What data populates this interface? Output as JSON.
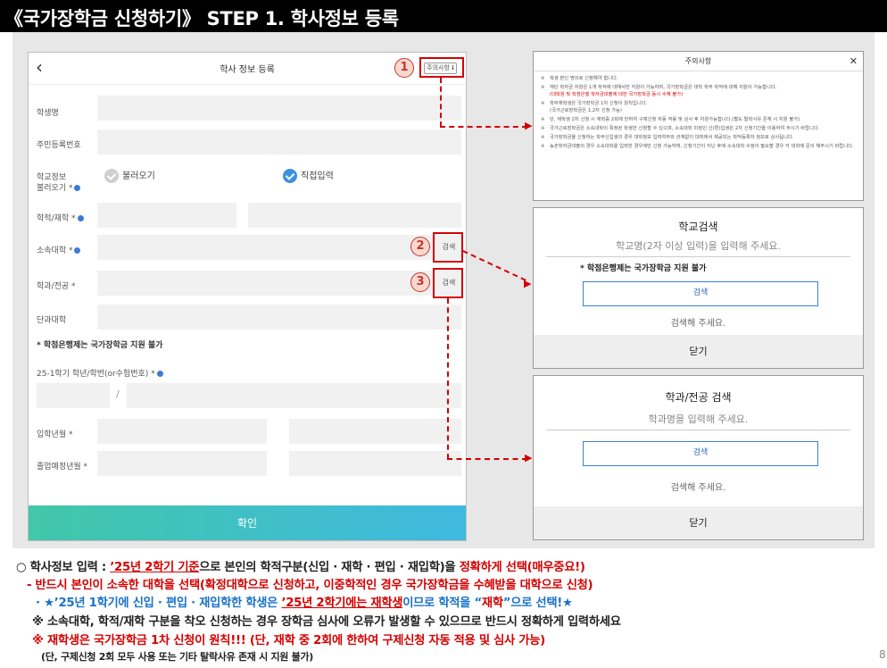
{
  "header": {
    "title": "《국가장학금 신청하기》 STEP 1. 학사정보 등록"
  },
  "form": {
    "title": "학사 정보 등록",
    "notice_button": "주의사항",
    "fields": {
      "name": "학생명",
      "rrn": "주민등록번호",
      "school_info_line1": "학교정보",
      "school_info_line2": "불러오기 *",
      "status": "학적/재학 *",
      "university": "소속대학 *",
      "department": "학과/전공 *",
      "college": "단과대학",
      "grade": "25-1학기 학년/학번(or수험번호) *",
      "admission": "입학년월 *",
      "graduation": "졸업예정년월 *"
    },
    "radio_load": "불러오기",
    "radio_direct": "직접입력",
    "search_label": "검색",
    "credit_bank_note": "* 학점은행제는 국가장학금 지원 불가",
    "slash": "/",
    "confirm_button": "확인"
  },
  "markers": [
    "1",
    "2",
    "3"
  ],
  "notice_panel": {
    "title": "주의사항",
    "close": "✕",
    "items": [
      {
        "text": "학생 본인 명의로 신청해야 합니다.",
        "red": "",
        "sub": ""
      },
      {
        "text": "재단 학자금 지원은 1개 학적에 대해서만 지원이 가능하며, 국가장학금은 대학 학부 학적에 대해 지원이 가능합니다.",
        "red": "(대학원 및 학점은행 학자금대출에 대한 국가장학금 동시 수혜 불가)",
        "sub": ""
      },
      {
        "text": "학부재학생은 국가장학금 1차 신청이 원칙입니다.",
        "red": "",
        "sub": "(국가근로장학금은 1,2차 신청 가능)"
      },
      {
        "text": "단, 재학생 2차 신청 시 재학중 2회에 한하여 구제신청 자동 적용 및 심사 후 지원가능합니다.(별도 탈락사유 존재 시 지원 불가)",
        "red": "",
        "sub": ""
      },
      {
        "text": "국가근로장학금은 소속대학이 확정된 학생만 신청할 수 있으며, 소속대학 미정인 신(편)입생은 2차 신청기간을 이용하여 주시기 바랍니다.",
        "red": "",
        "sub": ""
      },
      {
        "text": "국가장학금을 신청하는 학부신입생의 경우 대학정보 입력여부와 관계없이 대학에서 제공되는 학적등록자 정보로 심사됩니다.",
        "red": "",
        "sub": ""
      },
      {
        "text": "농촌학자금대출의 경우 소속대학을 입력한 경우에만 신청 가능하며, 신청기간이 지난 후에 소속대학 수정이 필요할 경우 각 대학에 문의 해주시기 바랍니다.",
        "red": "",
        "sub": ""
      }
    ]
  },
  "school_search_panel": {
    "title": "학교검색",
    "placeholder": "학교명(2자 이상 입력)을 입력해 주세요.",
    "note": "* 학점은행제는 국가장학금 지원 불가",
    "search_button": "검색",
    "hint": "검색해 주세요.",
    "close_button": "닫기"
  },
  "dept_search_panel": {
    "title": "학과/전공 검색",
    "placeholder": "학과명을 입력해 주세요.",
    "search_button": "검색",
    "hint": "검색해 주세요.",
    "close_button": "닫기"
  },
  "bottom_notes": {
    "l1a": "○ 학사정보 입력 : ",
    "l1b": "’25년 2학기 기준",
    "l1c": "으로 본인의 학적구분(신입 · 재학 · 편입 · 재입학)을 ",
    "l1d": "정확하게 선택(매우중요!)",
    "l2": "- 반드시 본인이 소속한 대학을 선택(확정대학으로 신청하고, 이중학적인 경우 국가장학금을 수혜받을 대학으로 신청)",
    "l3a": "· ★’25년 1학기에 신입 · 편입 · 재입학한 학생은 ",
    "l3b": "’25년 2학기에는 재학생",
    "l3c": "이므로 학적을 “",
    "l3d": "재학",
    "l3e": "”으로 선택!★",
    "l4": "※ 소속대학, 학적/재학 구분을 착오 신청하는 경우 장학금 심사에 오류가 발생할 수 있으므로 반드시 정확하게 입력하세요",
    "l5": "※ 재학생은 국가장학금 1차 신청이 원칙!!! (단, 재학 중 2회에 한하여 구제신청 자동 적용 및 심사 가능)",
    "l6": "(단, 구제신청 2회 모두 사용 또는 기타 탈락사유 존재 시 지원 불가)"
  },
  "page_number": "8",
  "colors": {
    "accent_red": "#d40000",
    "accent_blue": "#1a73c8",
    "confirm_start": "#41c7a9",
    "confirm_end": "#3fb9e0"
  }
}
